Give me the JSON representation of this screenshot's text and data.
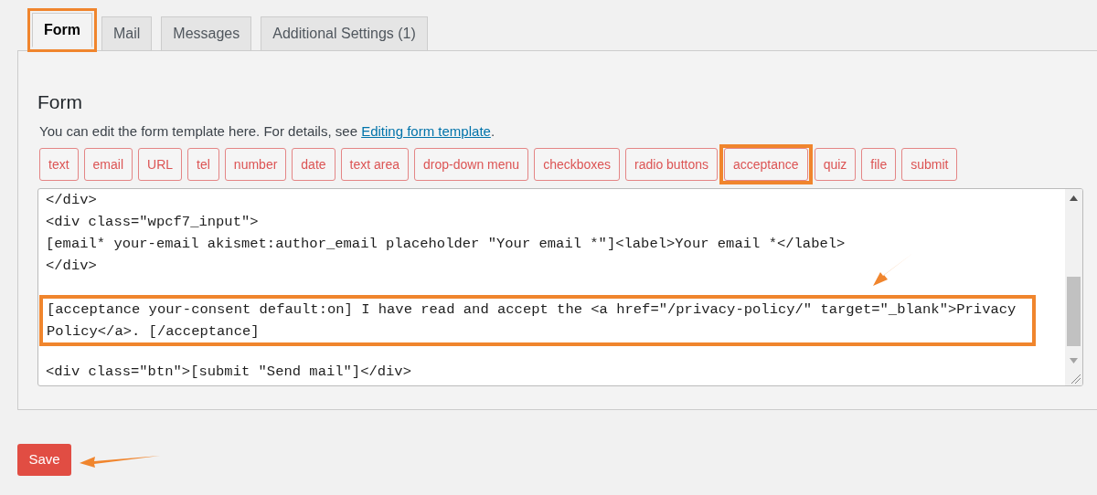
{
  "tabs": [
    {
      "label": "Form",
      "selected": true,
      "highlighted": true
    },
    {
      "label": "Mail",
      "selected": false,
      "highlighted": false
    },
    {
      "label": "Messages",
      "selected": false,
      "highlighted": false
    },
    {
      "label": "Additional Settings (1)",
      "selected": false,
      "highlighted": false
    }
  ],
  "panel": {
    "heading": "Form",
    "description": "You can edit the form template here. For details, see ",
    "link": "Editing form template",
    "after_link": "."
  },
  "tag_buttons": [
    {
      "label": "text",
      "highlighted": false
    },
    {
      "label": "email",
      "highlighted": false
    },
    {
      "label": "URL",
      "highlighted": false
    },
    {
      "label": "tel",
      "highlighted": false
    },
    {
      "label": "number",
      "highlighted": false
    },
    {
      "label": "date",
      "highlighted": false
    },
    {
      "label": "text area",
      "highlighted": false
    },
    {
      "label": "drop-down menu",
      "highlighted": false
    },
    {
      "label": "checkboxes",
      "highlighted": false
    },
    {
      "label": "radio buttons",
      "highlighted": false
    },
    {
      "label": "acceptance",
      "highlighted": true
    },
    {
      "label": "quiz",
      "highlighted": false
    },
    {
      "label": "file",
      "highlighted": false
    },
    {
      "label": "submit",
      "highlighted": false
    }
  ],
  "editor_blocks": [
    {
      "highlighted": false,
      "arrow": false,
      "lines": [
        "</div>",
        "<div class=\"wpcf7_input\">",
        "[email* your-email akismet:author_email placeholder \"Your email *\"]<label>Your email *</label>",
        "</div>"
      ]
    },
    {
      "highlighted": true,
      "arrow": true,
      "lines": [
        "[acceptance your-consent default:on] I have read and accept the <a href=\"/privacy-policy/\" target=\"_blank\">Privacy",
        "Policy</a>. [/acceptance]"
      ]
    },
    {
      "highlighted": false,
      "arrow": false,
      "lines": [
        "<div class=\"btn\">[submit \"Send mail\"]</div>"
      ]
    }
  ],
  "save_button": {
    "label": "Save",
    "arrow": true
  }
}
